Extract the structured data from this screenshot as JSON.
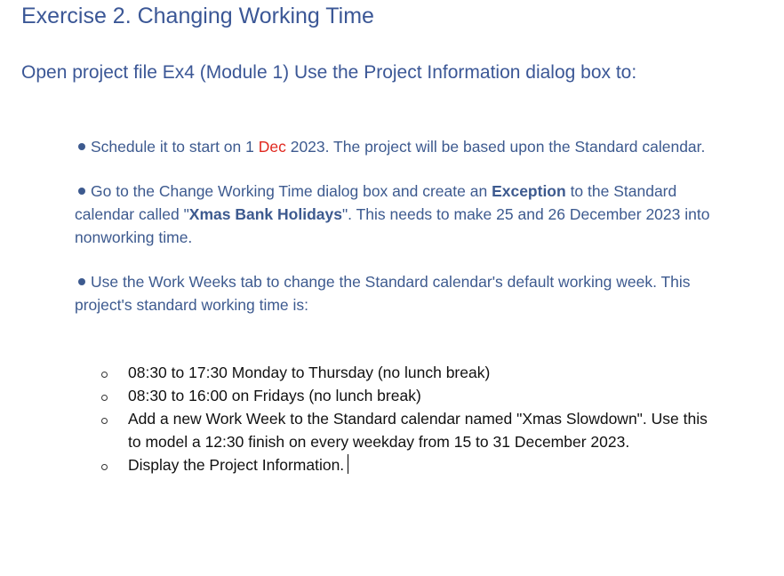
{
  "document": {
    "title": "Exercise 2. Changing Working Time",
    "intro": "Open project file Ex4 (Module 1) Use the Project Information dialog box to:",
    "bullets": [
      {
        "a": "Schedule it to start on 1 ",
        "red": "Dec",
        "b": " 2023. The project will be based upon the Standard calendar."
      },
      {
        "a": "Go to the Change Working Time dialog box and create an ",
        "bold1": "Exception",
        "b": " to the Standard calendar called \"",
        "bold2": "Xmas Bank Holidays",
        "c": "\". This needs to make 25 and 26 December 2023 into nonworking time."
      },
      {
        "a": "Use the Work Weeks tab to change the Standard calendar's default working week. This project's standard working time is:"
      }
    ],
    "subitems": [
      "08:30 to 17:30 Monday to Thursday (no lunch break)",
      "08:30 to 16:00 on Fridays (no lunch break)",
      "Add a new Work Week to the Standard calendar named \"Xmas Slowdown\". Use this to model a 12:30 finish on every weekday from 15 to 31 December 2023.",
      "Display the Project Information."
    ]
  },
  "colors": {
    "heading": "#3b5796",
    "body_blue": "#3d5a8f",
    "highlight_red": "#e0281f",
    "sub_text": "#111111"
  }
}
